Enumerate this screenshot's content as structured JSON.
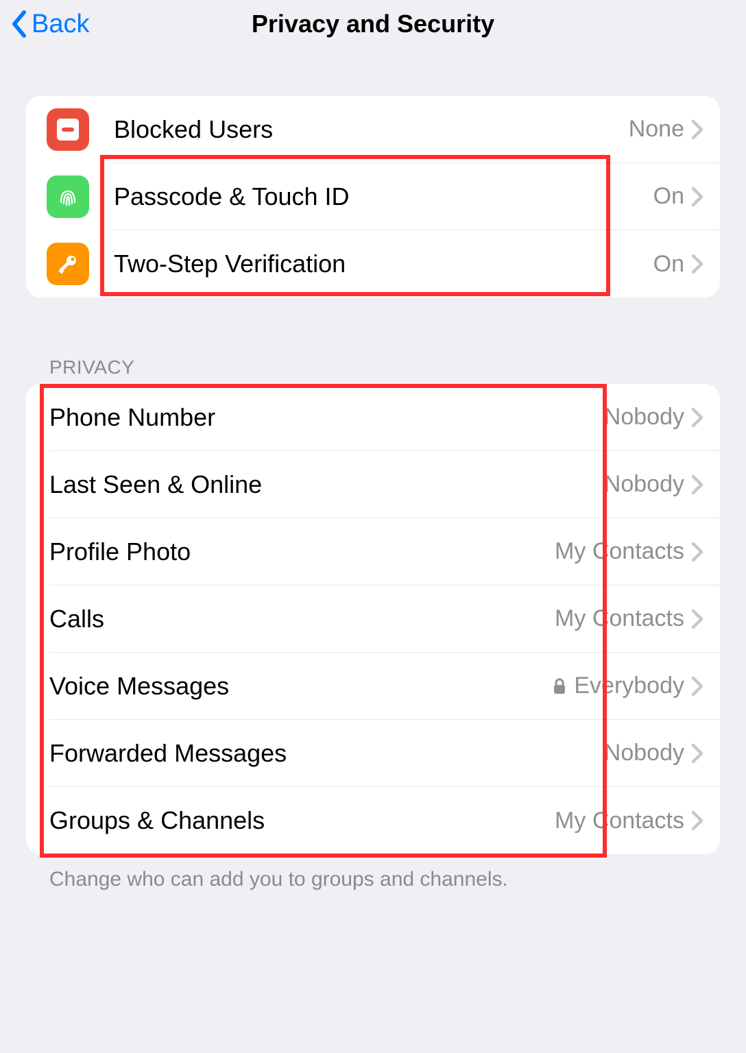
{
  "nav": {
    "back_label": "Back",
    "title": "Privacy and Security"
  },
  "security_group": {
    "items": [
      {
        "label": "Blocked Users",
        "value": "None",
        "icon": "blocked-icon"
      },
      {
        "label": "Passcode & Touch ID",
        "value": "On",
        "icon": "fingerprint-icon"
      },
      {
        "label": "Two-Step Verification",
        "value": "On",
        "icon": "key-icon"
      }
    ]
  },
  "privacy_header": "PRIVACY",
  "privacy_group": {
    "items": [
      {
        "label": "Phone Number",
        "value": "Nobody",
        "locked": false
      },
      {
        "label": "Last Seen & Online",
        "value": "Nobody",
        "locked": false
      },
      {
        "label": "Profile Photo",
        "value": "My Contacts",
        "locked": false
      },
      {
        "label": "Calls",
        "value": "My Contacts",
        "locked": false
      },
      {
        "label": "Voice Messages",
        "value": "Everybody",
        "locked": true
      },
      {
        "label": "Forwarded Messages",
        "value": "Nobody",
        "locked": false
      },
      {
        "label": "Groups & Channels",
        "value": "My Contacts",
        "locked": false
      }
    ]
  },
  "footer": "Change who can add you to groups and channels."
}
